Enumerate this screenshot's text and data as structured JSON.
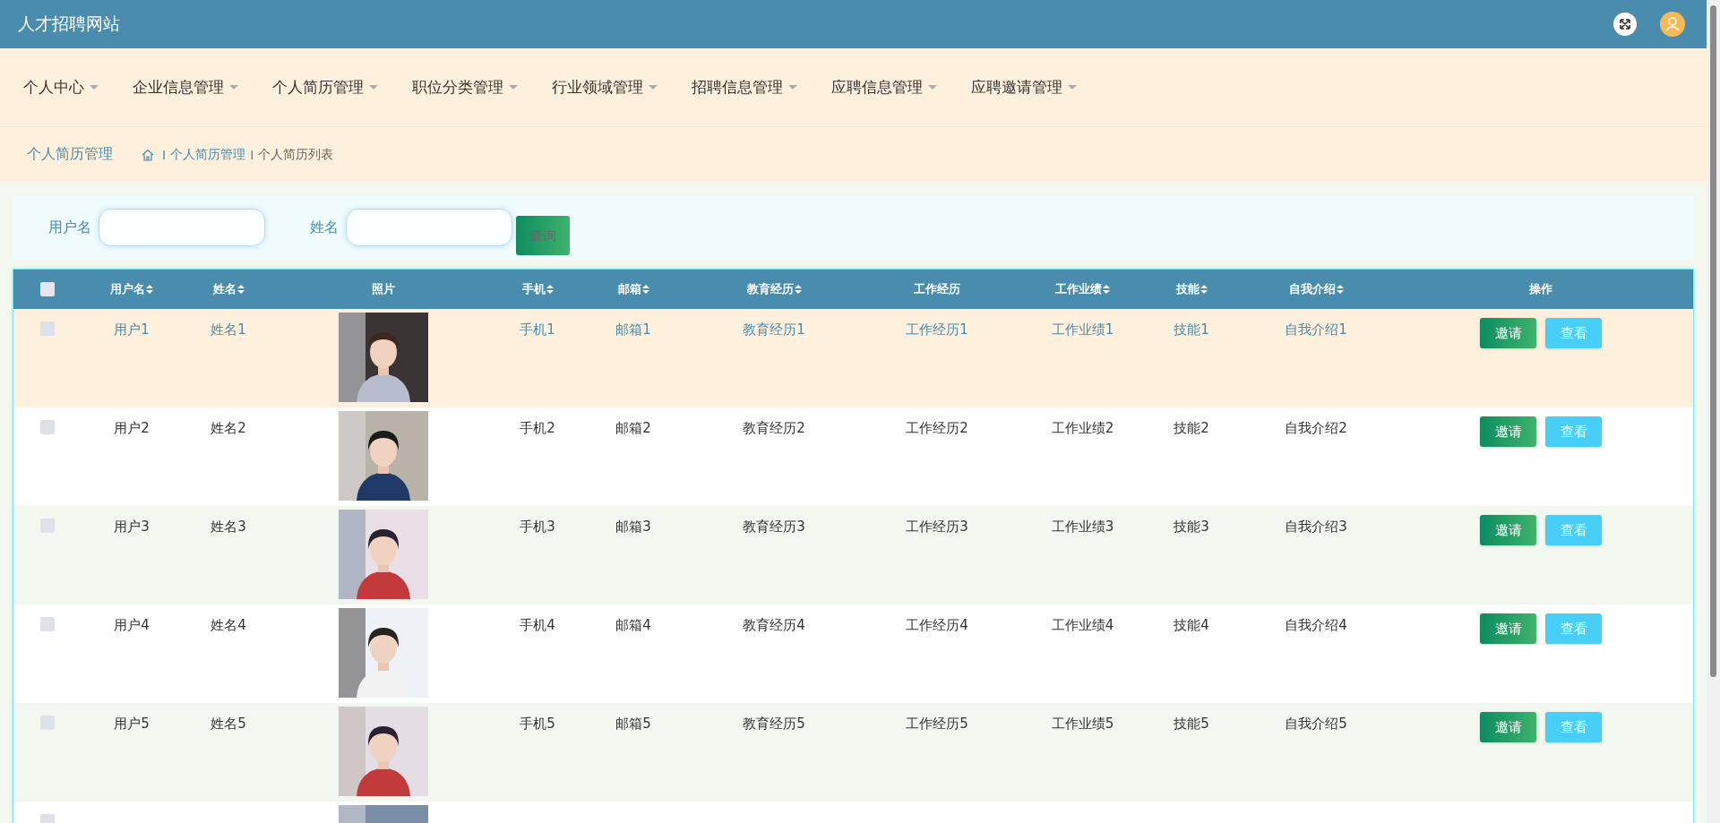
{
  "header": {
    "title": "人才招聘网站"
  },
  "nav": [
    {
      "label": "个人中心"
    },
    {
      "label": "企业信息管理"
    },
    {
      "label": "个人简历管理"
    },
    {
      "label": "职位分类管理"
    },
    {
      "label": "行业领域管理"
    },
    {
      "label": "招聘信息管理"
    },
    {
      "label": "应聘信息管理"
    },
    {
      "label": "应聘邀请管理"
    }
  ],
  "breadcrumb": {
    "title": "个人简历管理",
    "items": [
      {
        "separator": "I",
        "label": "个人简历管理"
      },
      {
        "separator": "I",
        "label": "个人简历列表"
      }
    ]
  },
  "search": {
    "fields": [
      {
        "label": "用户名"
      },
      {
        "label": "姓名"
      }
    ],
    "button": "查询"
  },
  "table": {
    "select_all_checked": false,
    "columns": [
      {
        "label": "用户名",
        "sortable": true
      },
      {
        "label": "姓名",
        "sortable": true
      },
      {
        "label": "照片",
        "sortable": false
      },
      {
        "label": "手机",
        "sortable": true
      },
      {
        "label": "邮箱",
        "sortable": true
      },
      {
        "label": "教育经历",
        "sortable": true
      },
      {
        "label": "工作经历",
        "sortable": false
      },
      {
        "label": "工作业绩",
        "sortable": true
      },
      {
        "label": "技能",
        "sortable": true
      },
      {
        "label": "自我介绍",
        "sortable": true
      },
      {
        "label": "操作",
        "sortable": false
      }
    ],
    "rows": [
      {
        "selected": true,
        "checked": false,
        "cells": [
          "用户1",
          "姓名1",
          {
            "kind": "picture"
          },
          "手机1",
          "邮箱1",
          "教育经历1",
          "工作经历1",
          "工作业绩1",
          "技能1",
          "自我介绍1"
        ],
        "actions": [
          "邀请",
          "查看"
        ]
      },
      {
        "selected": false,
        "checked": false,
        "cells": [
          "用户2",
          "姓名2",
          {
            "kind": "picture"
          },
          "手机2",
          "邮箱2",
          "教育经历2",
          "工作经历2",
          "工作业绩2",
          "技能2",
          "自我介绍2"
        ],
        "actions": [
          "邀请",
          "查看"
        ]
      },
      {
        "selected": false,
        "checked": false,
        "cells": [
          "用户3",
          "姓名3",
          {
            "kind": "picture"
          },
          "手机3",
          "邮箱3",
          "教育经历3",
          "工作经历3",
          "工作业绩3",
          "技能3",
          "自我介绍3"
        ],
        "actions": [
          "邀请",
          "查看"
        ]
      },
      {
        "selected": false,
        "checked": false,
        "cells": [
          "用户4",
          "姓名4",
          {
            "kind": "picture"
          },
          "手机4",
          "邮箱4",
          "教育经历4",
          "工作经历4",
          "工作业绩4",
          "技能4",
          "自我介绍4"
        ],
        "actions": [
          "邀请",
          "查看"
        ]
      },
      {
        "selected": false,
        "checked": false,
        "cells": [
          "用户5",
          "姓名5",
          {
            "kind": "picture"
          },
          "手机5",
          "邮箱5",
          "教育经历5",
          "工作经历5",
          "工作业绩5",
          "技能5",
          "自我介绍5"
        ],
        "actions": [
          "邀请",
          "查看"
        ]
      },
      {
        "selected": false,
        "checked": false,
        "cells": [
          {
            "kind": "picture"
          }
        ]
      }
    ]
  }
}
